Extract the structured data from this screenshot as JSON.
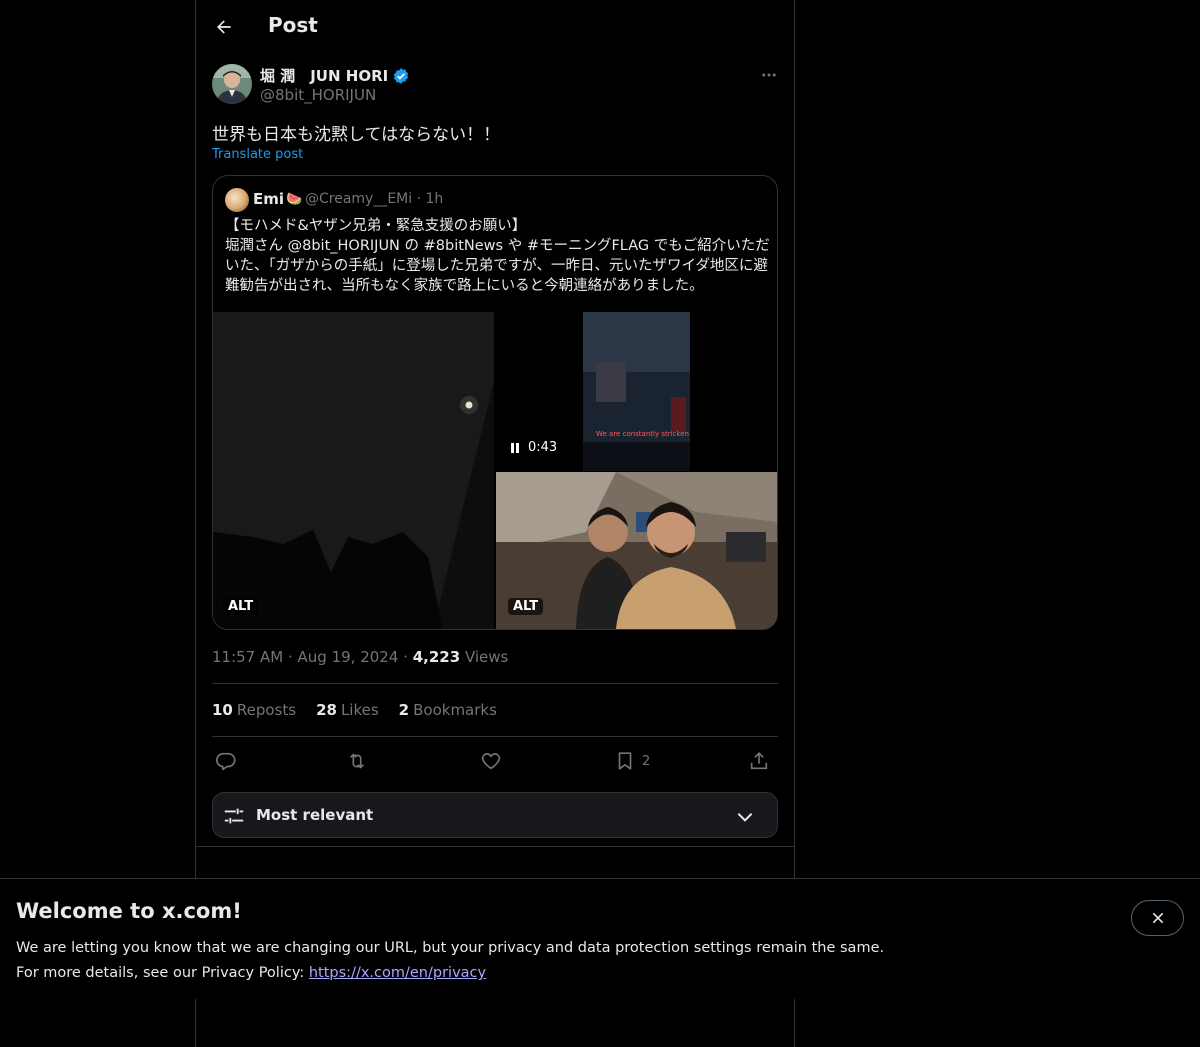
{
  "header": {
    "title": "Post"
  },
  "author": {
    "name": "堀 潤　JUN HORI",
    "handle": "@8bit_HORIJUN",
    "verified": true
  },
  "post": {
    "text": "世界も日本も沈黙してはならない！！",
    "translate_label": "Translate post"
  },
  "quote": {
    "name": "Emi",
    "emoji": "🍉",
    "handle": "@Creamy__EMi",
    "time": "1h",
    "text_line1": "【モハメド&ヤザン兄弟・緊急支援のお願い】",
    "text_body": "堀潤さん @8bit_HORIJUN の #8bitNews や #モーニングFLAG でもご紹介いただいた、「ガザからの手紙」に登場した兄弟ですが、一昨日、元いたザワイダ地区に避難勧告が出され、当所もなく家族で路上にいると今朝連絡がありました。",
    "media": {
      "left_alt": "ALT",
      "video_time": "0:43",
      "video_subtitle": "We are constantly stricken",
      "right_alt": "ALT"
    }
  },
  "meta": {
    "time": "11:57 AM",
    "date": "Aug 19, 2024",
    "views_count": "4,223",
    "views_label": "Views"
  },
  "stats": {
    "reposts_count": "10",
    "reposts_label": "Reposts",
    "likes_count": "28",
    "likes_label": "Likes",
    "bookmarks_count": "2",
    "bookmarks_label": "Bookmarks"
  },
  "actions": {
    "bookmark_count": "2"
  },
  "sort": {
    "label": "Most relevant"
  },
  "banner": {
    "title": "Welcome to x.com!",
    "line1": "We are letting you know that we are changing our URL, but your privacy and data protection settings remain the same.",
    "line2_prefix": "For more details, see our Privacy Policy: ",
    "link": "https://x.com/en/privacy"
  },
  "colors": {
    "accent": "#1d9bf0",
    "background": "#000000",
    "muted": "#71767b",
    "border": "#2f3336"
  }
}
